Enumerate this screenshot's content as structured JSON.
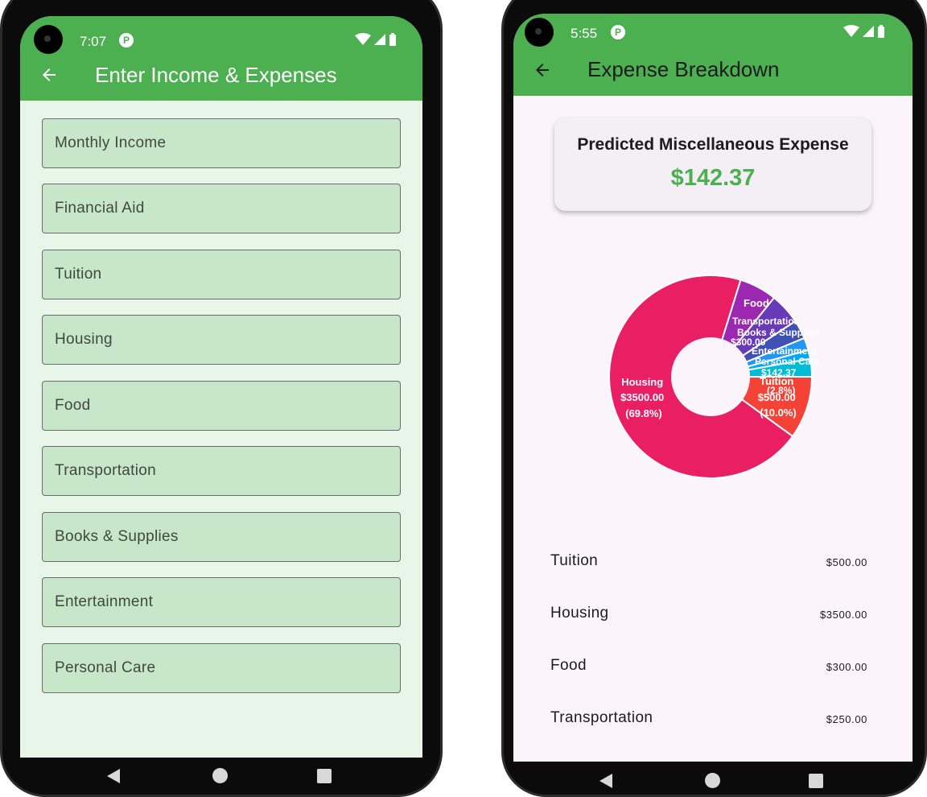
{
  "screen1": {
    "status": {
      "time": "7:07",
      "badge": "P"
    },
    "appbar": {
      "title": "Enter Income & Expenses"
    },
    "fields": [
      {
        "label": "Monthly Income"
      },
      {
        "label": "Financial Aid"
      },
      {
        "label": "Tuition"
      },
      {
        "label": "Housing"
      },
      {
        "label": "Food"
      },
      {
        "label": "Transportation"
      },
      {
        "label": "Books & Supplies"
      },
      {
        "label": "Entertainment"
      },
      {
        "label": "Personal Care"
      }
    ]
  },
  "screen2": {
    "status": {
      "time": "5:55",
      "badge": "P"
    },
    "appbar": {
      "title": "Expense Breakdown"
    },
    "card": {
      "title": "Predicted Miscellaneous Expense",
      "value": "$142.37"
    },
    "chart": {
      "housing_label": [
        "Housing",
        "$3500.00",
        "(69.8%)"
      ],
      "tuition_label": [
        "Tuition",
        "$500.00",
        "(10.0%)"
      ],
      "food_label": "Food",
      "misc_label": [
        "(2.8%)",
        "$142.37"
      ],
      "overlap_labels": [
        "Transportation",
        "Books & Supplies",
        "$300.00",
        "Entertainment",
        "Personal Care"
      ]
    },
    "expenses": [
      {
        "name": "Tuition",
        "amount": "$500.00"
      },
      {
        "name": "Housing",
        "amount": "$3500.00"
      },
      {
        "name": "Food",
        "amount": "$300.00"
      },
      {
        "name": "Transportation",
        "amount": "$250.00"
      }
    ]
  },
  "colors": {
    "green": "#4caf50",
    "field_bg": "#c8e6c9",
    "screen_bg": "#e8f5e9",
    "housing": "#e91e63",
    "tuition": "#f44336",
    "food": "#9c27b0",
    "transportation": "#673ab7",
    "books": "#3f51b5",
    "entertainment": "#2196f3",
    "personal_care": "#03a9f4",
    "misc": "#00bcd4"
  },
  "chart_data": {
    "type": "pie",
    "categories": [
      "Tuition",
      "Housing",
      "Food",
      "Transportation",
      "Books & Supplies",
      "Entertainment",
      "Personal Care",
      "Misc"
    ],
    "values": [
      500.0,
      3500.0,
      300.0,
      250.0,
      150.0,
      100.0,
      70.0,
      142.37
    ],
    "legend": "none"
  }
}
